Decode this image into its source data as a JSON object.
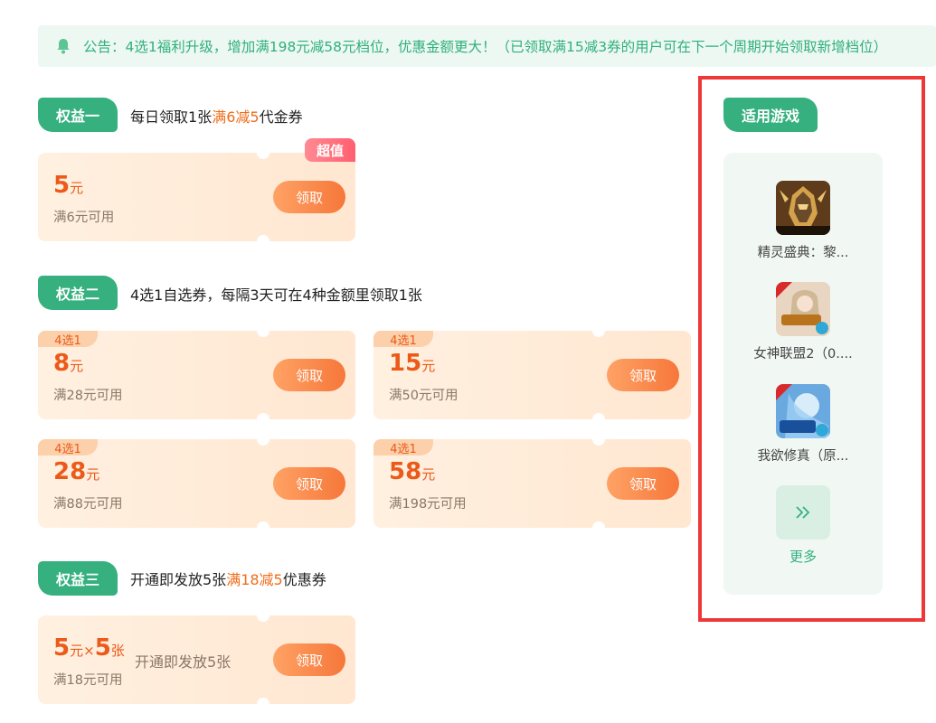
{
  "notice": {
    "text": "公告：4选1福利升级，增加满198元减58元档位，优惠金额更大！（已领取满15减3券的用户可在下一个周期开始领取新增档位）"
  },
  "benefit1": {
    "tag": "权益一",
    "desc_pre": "每日领取1张",
    "desc_hl": "满6减5",
    "desc_post": "代金券",
    "coupon": {
      "amount": "5",
      "unit": "元",
      "condition": "满6元可用",
      "button": "领取",
      "hot": "超值"
    }
  },
  "benefit2": {
    "tag": "权益二",
    "desc": "4选1自选券，每隔3天可在4种金额里领取1张",
    "coupons": [
      {
        "badge": "4选1",
        "amount": "8",
        "unit": "元",
        "condition": "满28元可用",
        "button": "领取"
      },
      {
        "badge": "4选1",
        "amount": "15",
        "unit": "元",
        "condition": "满50元可用",
        "button": "领取"
      },
      {
        "badge": "4选1",
        "amount": "28",
        "unit": "元",
        "condition": "满88元可用",
        "button": "领取"
      },
      {
        "badge": "4选1",
        "amount": "58",
        "unit": "元",
        "condition": "满198元可用",
        "button": "领取"
      }
    ]
  },
  "benefit3": {
    "tag": "权益三",
    "desc_pre": "开通即发放5张",
    "desc_hl": "满18减5",
    "desc_post": "优惠券",
    "coupon": {
      "amount": "5",
      "unit": "元",
      "times": "×",
      "count": "5",
      "count_unit": "张",
      "condition": "满18元可用",
      "middle": "开通即发放5张",
      "button": "领取"
    }
  },
  "sidebar": {
    "tag": "适用游戏",
    "games": [
      {
        "name": "精灵盛典：黎...",
        "icon": "warrior-helmet-game-icon"
      },
      {
        "name": "女神联盟2（0....",
        "icon": "goddess-game-icon"
      },
      {
        "name": "我欲修真（原...",
        "icon": "cultivation-game-icon"
      }
    ],
    "more_icon": "double-chevron-right-icon",
    "more_label": "更多"
  },
  "colors": {
    "accent_green": "#35b07e",
    "coupon_orange": "#ec5a19",
    "highlight_red_frame": "#ee3838"
  }
}
